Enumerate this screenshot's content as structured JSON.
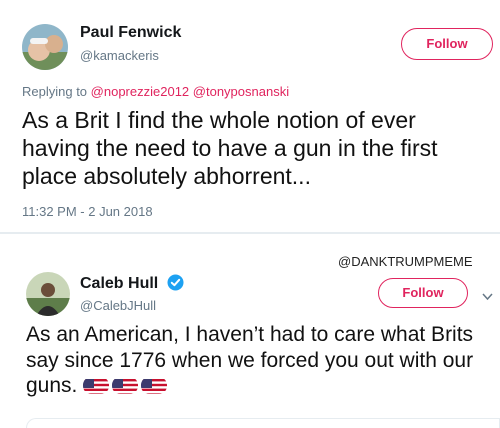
{
  "tweet1": {
    "display_name": "Paul Fenwick",
    "handle": "@kamackeris",
    "follow_label": "Follow",
    "replying_prefix": "Replying to",
    "reply_handles": [
      "@noprezzie2012",
      "@tonyposnanski"
    ],
    "text": "As a Brit I find the whole notion of ever having the need to have a gun in the first place absolutely abhorrent...",
    "timestamp": "11:32 PM - 2 Jun 2018"
  },
  "watermark": "@DANKTRUMPMEME",
  "tweet2": {
    "display_name": "Caleb Hull",
    "handle": "@CalebJHull",
    "verified_icon": "verified-badge-icon",
    "follow_label": "Follow",
    "menu_icon": "chevron-down-icon",
    "text": "As an American, I haven’t had to care what Brits say since 1776 when we forced you out with our guns.",
    "emoji": [
      "us-flag-icon",
      "us-flag-icon",
      "us-flag-icon"
    ]
  },
  "colors": {
    "accent": "#e0245e",
    "verified": "#1da1f2",
    "muted": "#657786"
  }
}
